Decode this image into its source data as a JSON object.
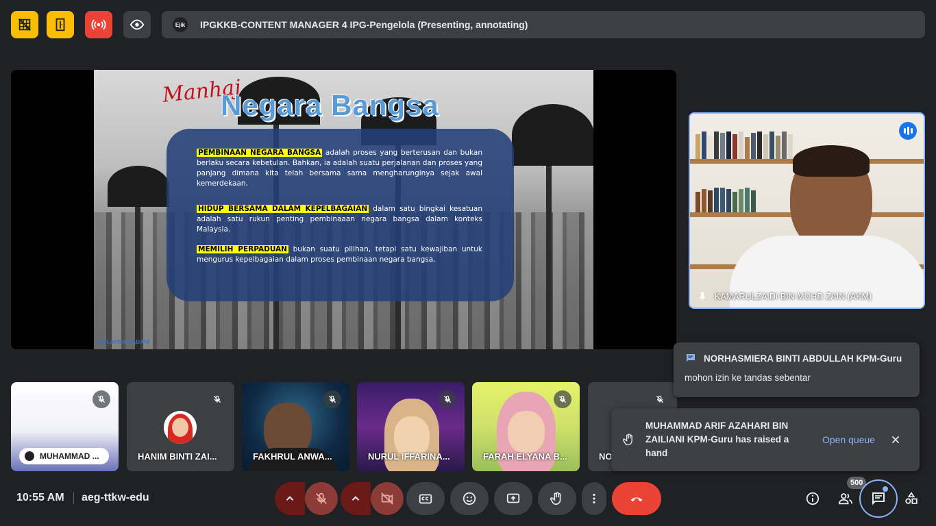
{
  "topbar": {
    "buttons": [
      {
        "icon": "no-video-grid-icon",
        "color": "#fbbc04"
      },
      {
        "icon": "door-exit-icon",
        "color": "#fbbc04"
      },
      {
        "icon": "broadcast-icon",
        "color": "#ea4335"
      },
      {
        "icon": "eye-icon",
        "color": "#3c4043"
      }
    ],
    "presenter_logo": "Ejik",
    "presenter_title": "IPGKKB-CONTENT MANAGER 4 IPG-Pengelola (Presenting, annotating)"
  },
  "slide": {
    "script_title": "Manhaj",
    "main_title": "Negara Bangsa",
    "paragraphs": [
      {
        "highlight": "PEMBINAAN NEGARA BANGSA",
        "text": " adalah proses yang berterusan dan bukan berlaku secara kebetulan. Bahkan, ia adalah suatu perjalanan dan proses yang panjang dimana kita telah bersama sama mengharunginya sejak awal kemerdekaan."
      },
      {
        "highlight": "HIDUP BERSAMA DALAM KEPELBAGAIAN",
        "text": " dalam satu bingkai kesatuan adalah satu rukun penting pembinaaan negara bangsa dalam konteks Malaysia."
      },
      {
        "highlight": "MEMILIH PERPADUAN",
        "text": " bukan suatu pilihan, tetapi satu kewajiban untuk mengurus kepelbagaian dalam proses pembinaan negara bangsa."
      }
    ],
    "corner_logo": "MALAYSIA MADANI"
  },
  "speaker": {
    "name": "KAMARULZAIDI BIN MOHD ZAIN (AKM)",
    "accent": "#8ab4f8"
  },
  "tiles": [
    {
      "name": "MUHAMMAD ...",
      "muted": true
    },
    {
      "name": "HANIM BINTI ZAI...",
      "muted": true
    },
    {
      "name": "FAKHRUL ANWA...",
      "muted": true
    },
    {
      "name": "NURUL IFFARINA...",
      "muted": true
    },
    {
      "name": "FARAH ELYANA B...",
      "muted": true
    },
    {
      "name": "NO",
      "muted": true
    }
  ],
  "chat_notification": {
    "sender": "NORHASMIERA BINTI ABDULLAH KPM-Guru",
    "message": "mohon izin ke tandas sebentar"
  },
  "hand_notification": {
    "message": "MUHAMMAD ARIF AZAHARI BIN ZAILIANI KPM-Guru has raised a hand",
    "action": "Open queue"
  },
  "bottombar": {
    "time": "10:55 AM",
    "meeting_code": "aeg-ttkw-edu",
    "participant_count": "500",
    "end_call_color": "#ea4335"
  }
}
